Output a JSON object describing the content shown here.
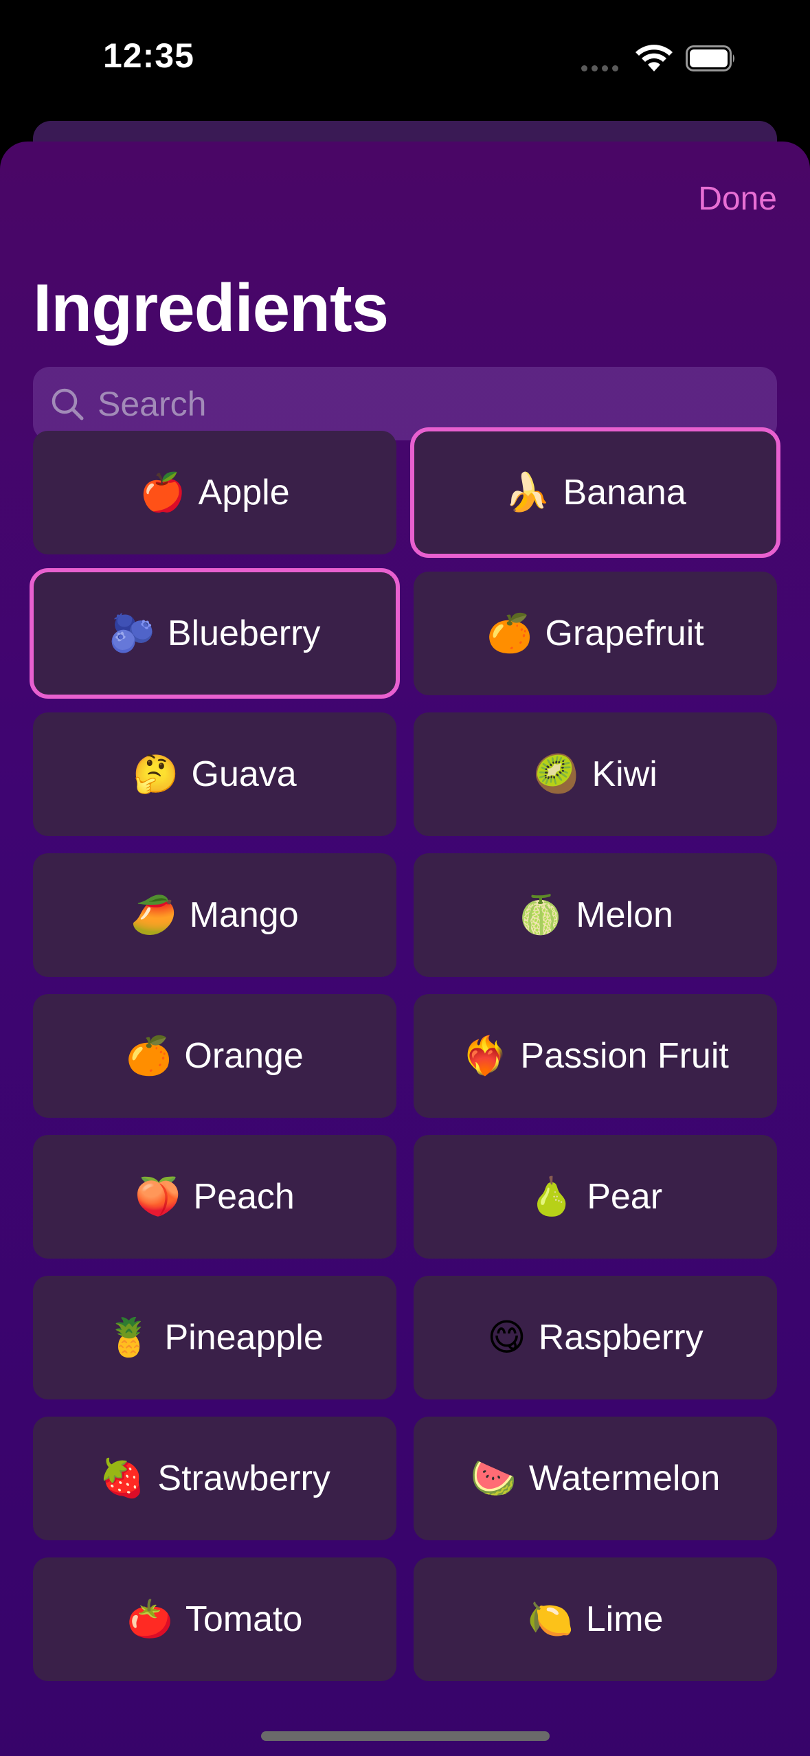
{
  "status_bar": {
    "time": "12:35"
  },
  "sheet": {
    "done_label": "Done",
    "title": "Ingredients",
    "search_placeholder": "Search"
  },
  "colors": {
    "accent": "#e86fd4",
    "sheet_background": "#3f0572",
    "tile_background": "#3a2049"
  },
  "ingredients": [
    {
      "emoji": "🍎",
      "label": "Apple",
      "selected": false
    },
    {
      "emoji": "🍌",
      "label": "Banana",
      "selected": true
    },
    {
      "emoji": "🫐",
      "label": "Blueberry",
      "selected": true
    },
    {
      "emoji": "🍊",
      "label": "Grapefruit",
      "selected": false
    },
    {
      "emoji": "🤔",
      "label": "Guava",
      "selected": false
    },
    {
      "emoji": "🥝",
      "label": "Kiwi",
      "selected": false
    },
    {
      "emoji": "🥭",
      "label": "Mango",
      "selected": false
    },
    {
      "emoji": "🍈",
      "label": "Melon",
      "selected": false
    },
    {
      "emoji": "🍊",
      "label": "Orange",
      "selected": false
    },
    {
      "emoji": "❤️‍🔥",
      "label": "Passion Fruit",
      "selected": false
    },
    {
      "emoji": "🍑",
      "label": "Peach",
      "selected": false
    },
    {
      "emoji": "🍐",
      "label": "Pear",
      "selected": false
    },
    {
      "emoji": "🍍",
      "label": "Pineapple",
      "selected": false
    },
    {
      "emoji": "😋",
      "label": "Raspberry",
      "selected": false
    },
    {
      "emoji": "🍓",
      "label": "Strawberry",
      "selected": false
    },
    {
      "emoji": "🍉",
      "label": "Watermelon",
      "selected": false
    },
    {
      "emoji": "🍅",
      "label": "Tomato",
      "selected": false
    },
    {
      "emoji": "🍋",
      "label": "Lime",
      "selected": false
    }
  ]
}
